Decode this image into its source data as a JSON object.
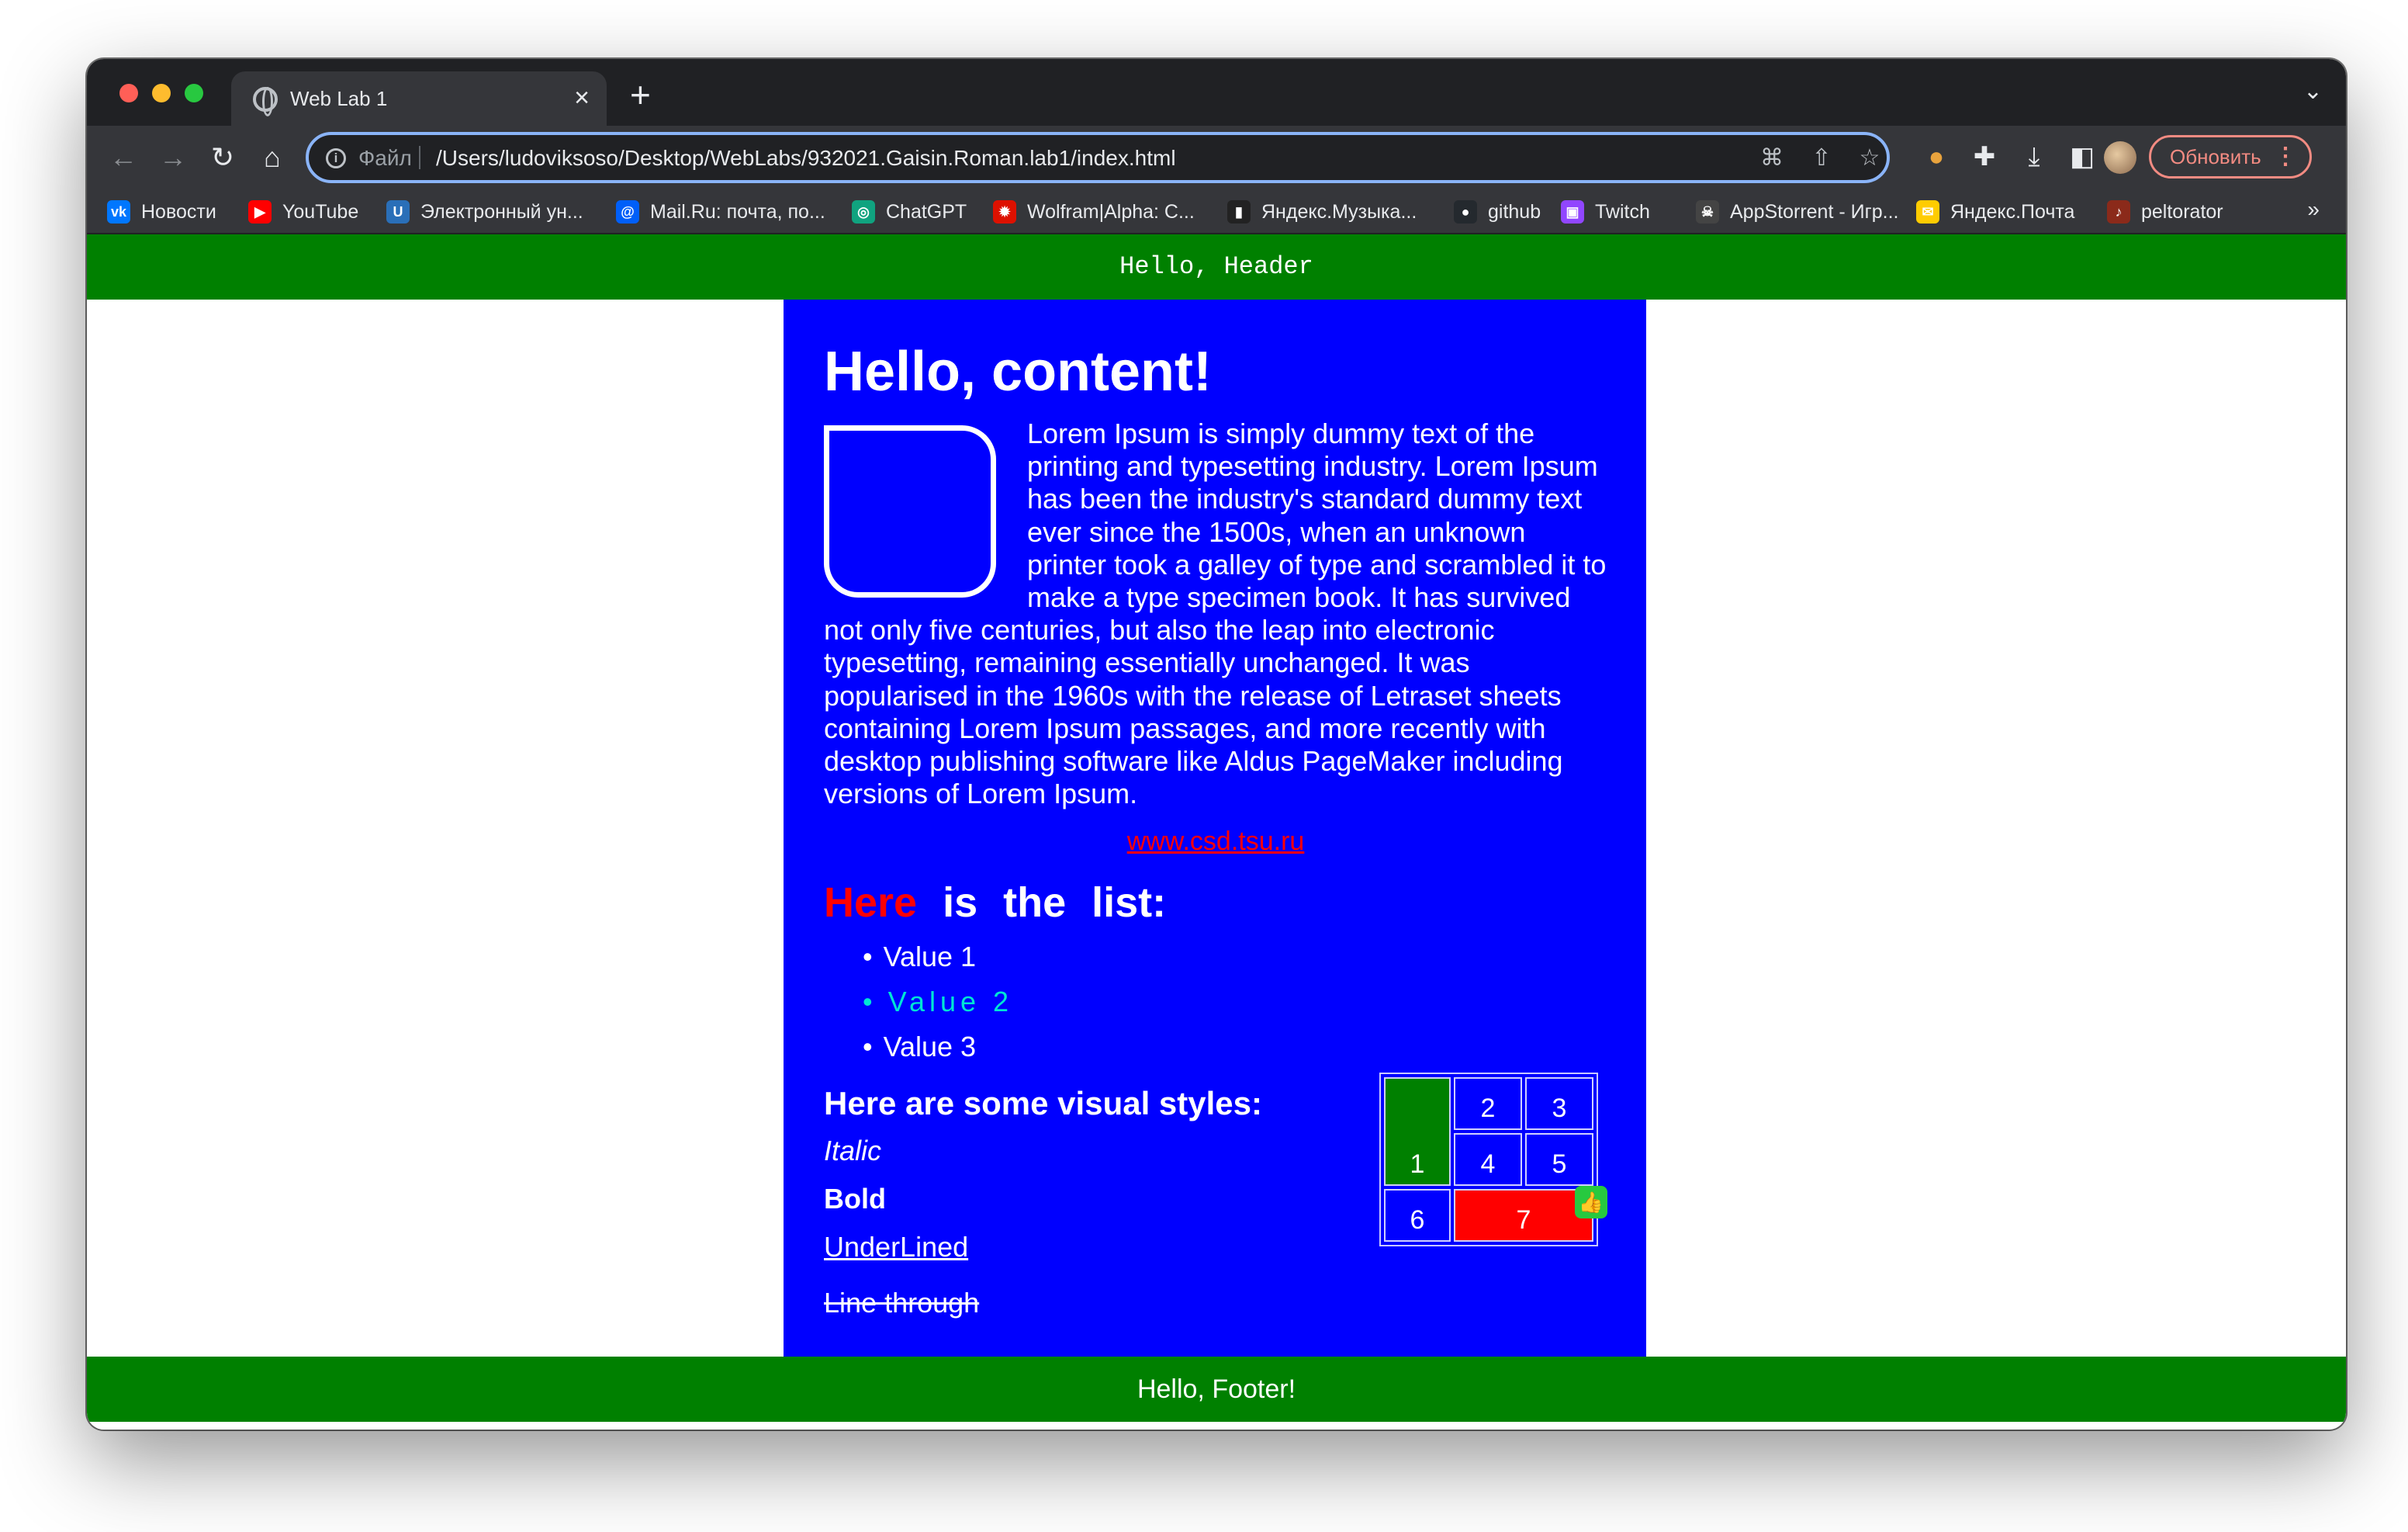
{
  "browser": {
    "tab_title": "Web Lab 1",
    "tab_close": "×",
    "new_tab": "+",
    "tab_menu": "⌄",
    "scheme_label": "Файл",
    "url": "/Users/ludoviksoso/Desktop/WebLabs/932021.Gaisin.Roman.lab1/index.html",
    "update_button": "Обновить",
    "update_menu": "⋮",
    "nav": {
      "back": "←",
      "forward": "→",
      "reload": "↻",
      "home": "⌂"
    }
  },
  "bookmarks": [
    {
      "label": "Новости",
      "icon": "vk-icon",
      "icon_text": "vk",
      "color": "#0077ff"
    },
    {
      "label": "YouTube",
      "icon": "youtube-icon",
      "icon_text": "▶",
      "color": "#ff0000"
    },
    {
      "label": "Электронный ун...",
      "icon": "university-icon",
      "icon_text": "U",
      "color": "#2a6fb8"
    },
    {
      "label": "Mail.Ru: почта, по...",
      "icon": "mailru-icon",
      "icon_text": "@",
      "color": "#005ff9"
    },
    {
      "label": "ChatGPT",
      "icon": "chatgpt-icon",
      "icon_text": "◎",
      "color": "#10a37f"
    },
    {
      "label": "Wolfram|Alpha: C...",
      "icon": "wolfram-icon",
      "icon_text": "✹",
      "color": "#dd1100"
    },
    {
      "label": "Яндекс.Музыка...",
      "icon": "yandex-music-icon",
      "icon_text": "▮",
      "color": "#222222"
    },
    {
      "label": "github",
      "icon": "github-icon",
      "icon_text": "●",
      "color": "#24292e"
    },
    {
      "label": "Twitch",
      "icon": "twitch-icon",
      "icon_text": "▣",
      "color": "#9146ff"
    },
    {
      "label": "AppStorrent - Игр...",
      "icon": "appstorrent-icon",
      "icon_text": "☠",
      "color": "#444444"
    },
    {
      "label": "Яндекс.Почта",
      "icon": "yandex-mail-icon",
      "icon_text": "✉",
      "color": "#ffcc00"
    },
    {
      "label": "peltorator",
      "icon": "peltorator-icon",
      "icon_text": "♪",
      "color": "#8b2a1a"
    }
  ],
  "bookmarks_more": "»",
  "page": {
    "header": "Hello, Header",
    "title": "Hello, content!",
    "lorem": "Lorem Ipsum is simply dummy text of the printing and typesetting industry. Lorem Ipsum has been the industry's standard dummy text ever since the 1500s, when an unknown printer took a galley of type and scrambled it to make a type specimen book. It has survived not only five centuries, but also the leap into electronic typesetting, remaining essentially unchanged. It was popularised in the 1960s with the release of Letraset sheets containing Lorem Ipsum passages, and more recently with desktop publishing software like Aldus PageMaker including versions of Lorem Ipsum.",
    "link": "www.csd.tsu.ru",
    "list_title_here": "Here",
    "list_title_rest": "is the list:",
    "list": [
      "Value 1",
      "Value 2",
      "Value 3"
    ],
    "bullet": "•",
    "styles_title": "Here are some visual styles:",
    "styles": {
      "italic": "Italic",
      "bold": "Bold",
      "underlined": "UnderLined",
      "line_through": "Line through"
    },
    "table": {
      "c1": "1",
      "c2": "2",
      "c3": "3",
      "c4": "4",
      "c5": "5",
      "c6": "6",
      "c7": "7"
    },
    "footer": "Hello, Footer!"
  },
  "colors": {
    "header_bg": "#008000",
    "content_bg": "#0000ff",
    "link": "#ff0000",
    "value2": "#00e5d4",
    "cell_red": "#ff0000"
  }
}
